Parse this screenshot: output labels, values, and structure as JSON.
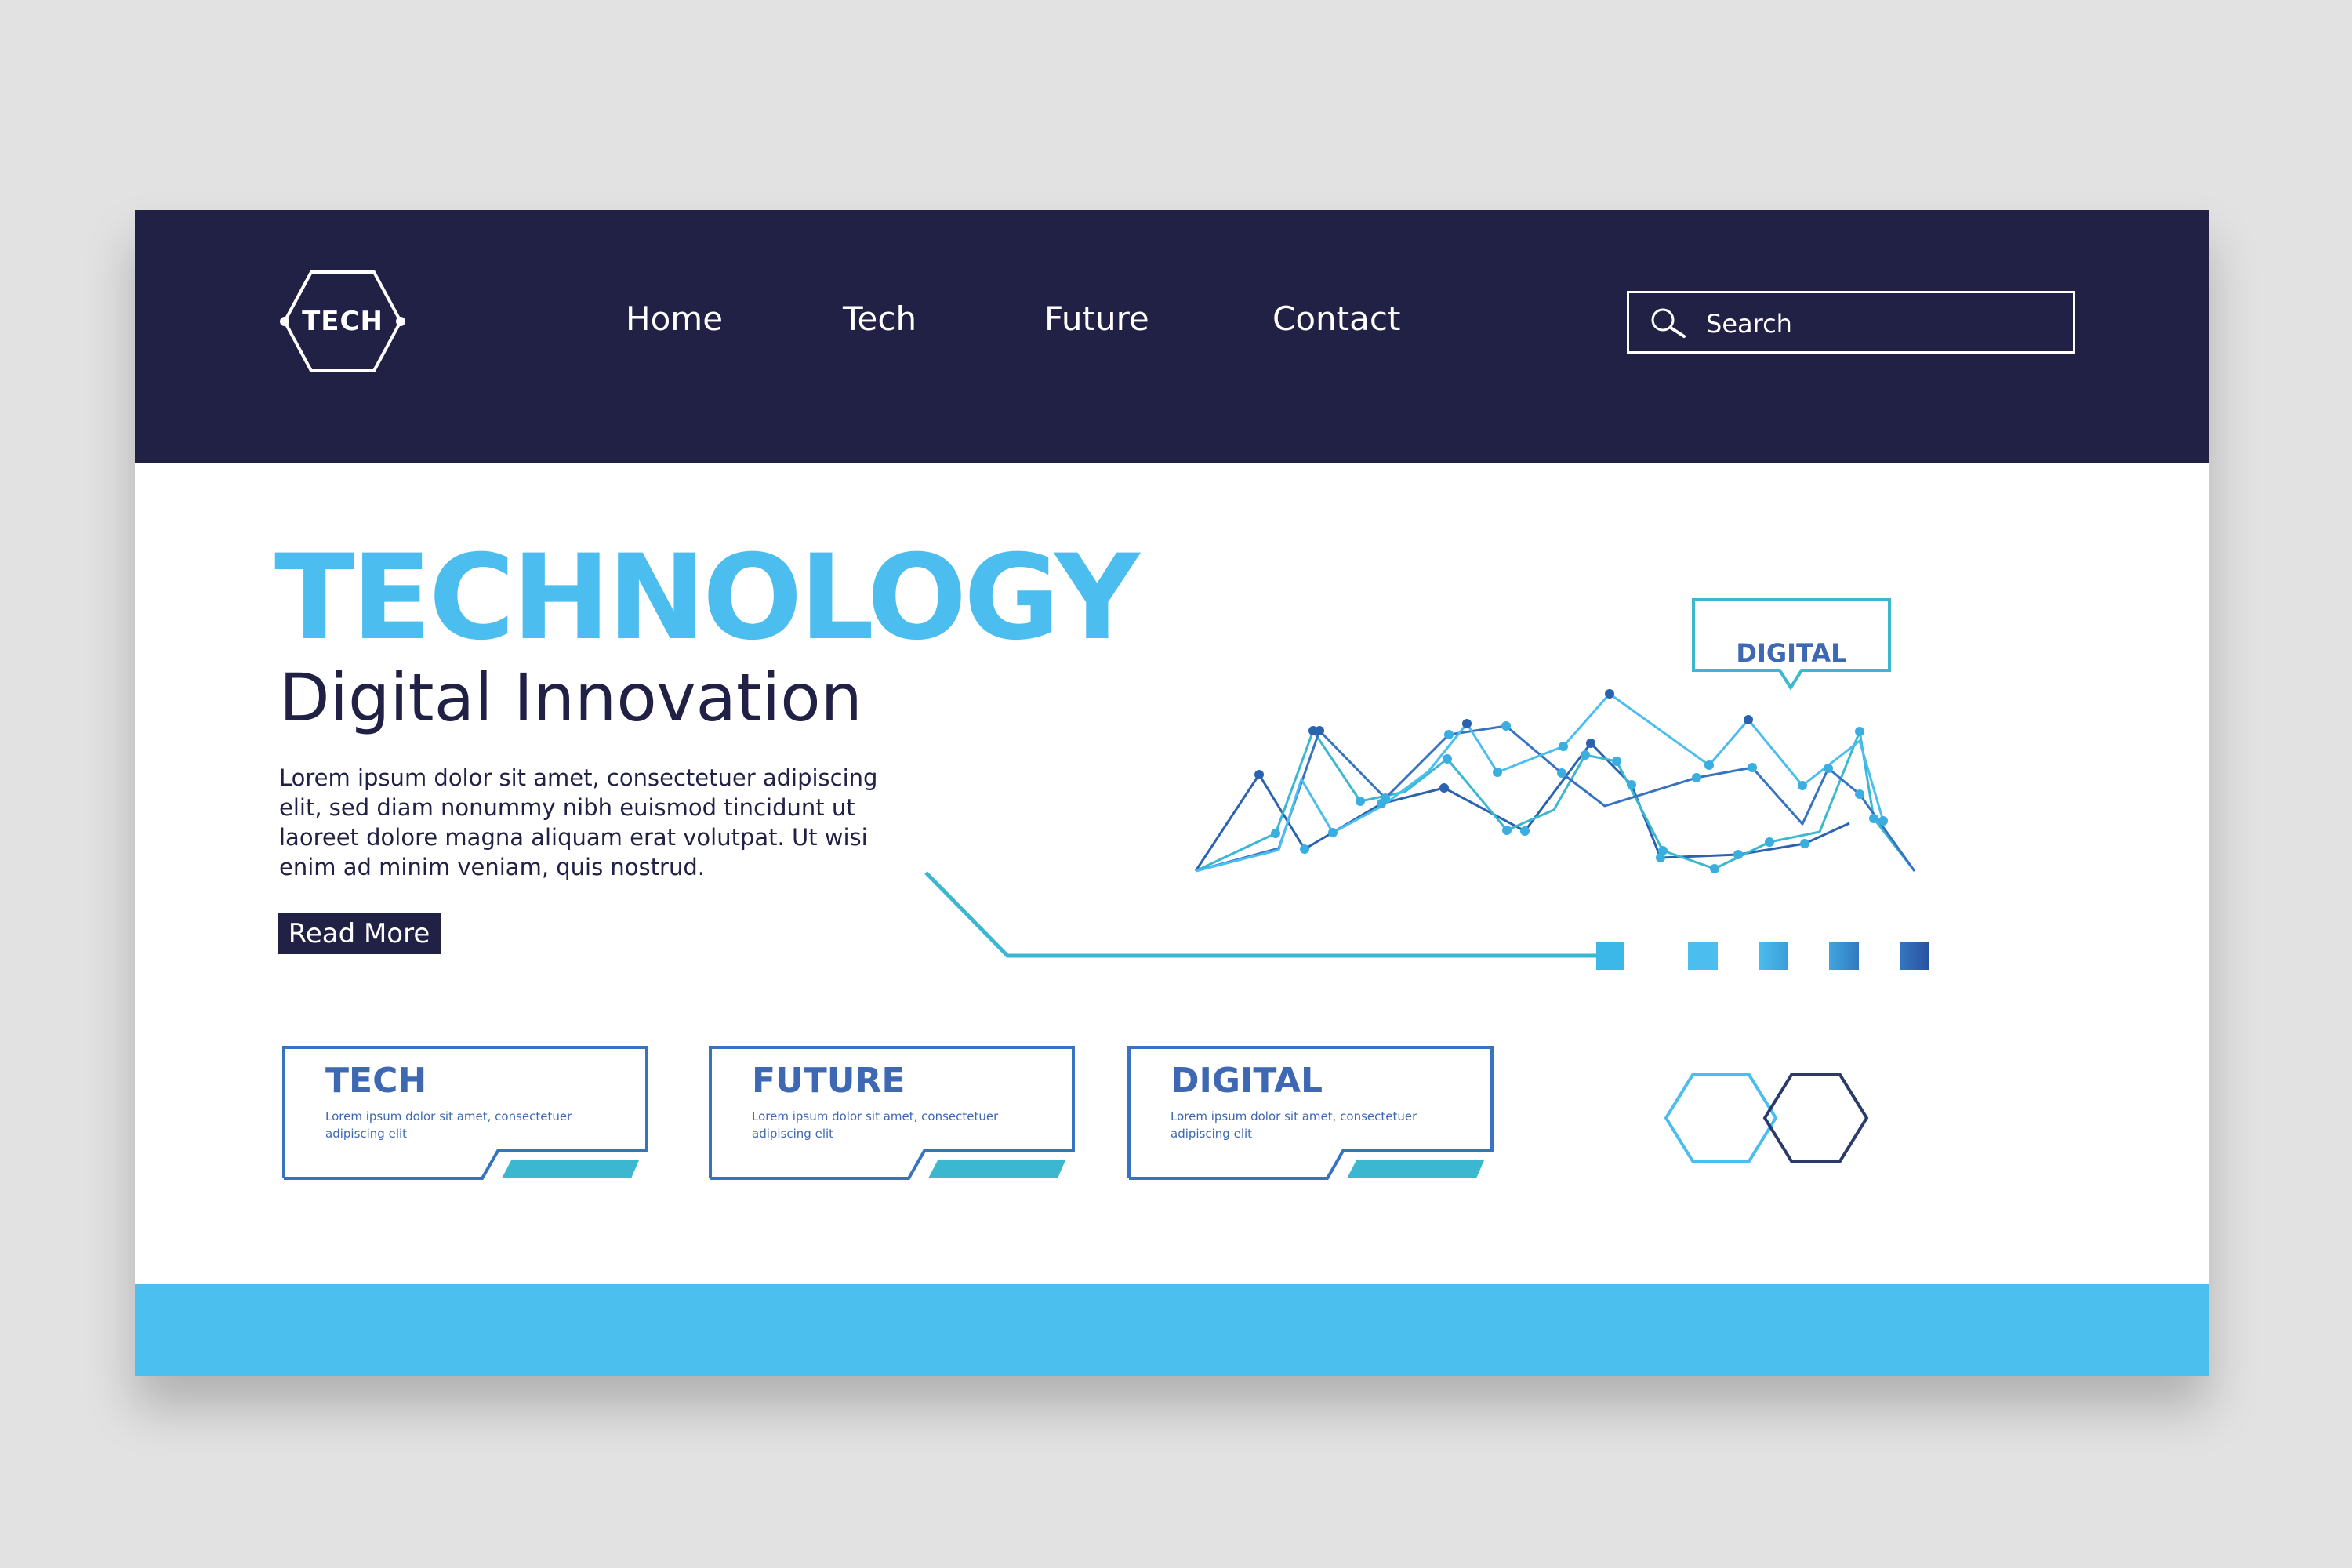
{
  "header": {
    "logo_text": "TECH",
    "nav": [
      "Home",
      "Tech",
      "Future",
      "Contact"
    ],
    "search_placeholder": "Search"
  },
  "hero": {
    "title": "TECHNOLOGY",
    "subtitle": "Digital Innovation",
    "body": "Lorem ipsum dolor sit amet, consectetuer adipiscing elit, sed diam nonummy nibh euismod tincidunt ut laoreet dolore magna aliquam erat volutpat. Ut wisi enim ad minim veniam, quis nostrud.",
    "button": "Read More"
  },
  "graphic": {
    "callout_label": "DIGITAL"
  },
  "cards": [
    {
      "title": "TECH",
      "body": "Lorem ipsum dolor sit amet, consectetuer adipiscing elit"
    },
    {
      "title": "FUTURE",
      "body": "Lorem ipsum dolor sit amet, consectetuer adipiscing elit"
    },
    {
      "title": "DIGITAL",
      "body": "Lorem ipsum dolor sit amet, consectetuer adipiscing elit"
    }
  ],
  "colors": {
    "navy": "#212146",
    "accent": "#4bbdee",
    "card_blue": "#3f68b2",
    "teal": "#3bb8d0"
  }
}
